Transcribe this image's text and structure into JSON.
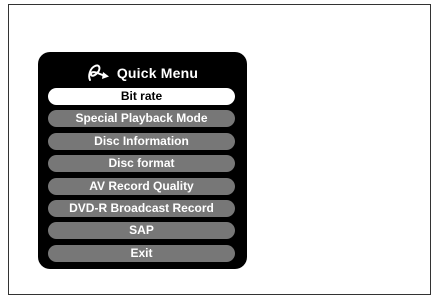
{
  "quick_menu": {
    "title": "Quick Menu",
    "items": [
      {
        "label": "Bit rate",
        "selected": true
      },
      {
        "label": "Special Playback Mode",
        "selected": false
      },
      {
        "label": "Disc Information",
        "selected": false
      },
      {
        "label": "Disc format",
        "selected": false
      },
      {
        "label": "AV Record Quality",
        "selected": false
      },
      {
        "label": "DVD-R Broadcast Record",
        "selected": false
      },
      {
        "label": "SAP",
        "selected": false
      },
      {
        "label": "Exit",
        "selected": false
      }
    ]
  },
  "colors": {
    "panel": "#000000",
    "item": "#777777",
    "item_selected": "#ffffff"
  },
  "icons": {
    "header": "remote-pointer-icon"
  }
}
